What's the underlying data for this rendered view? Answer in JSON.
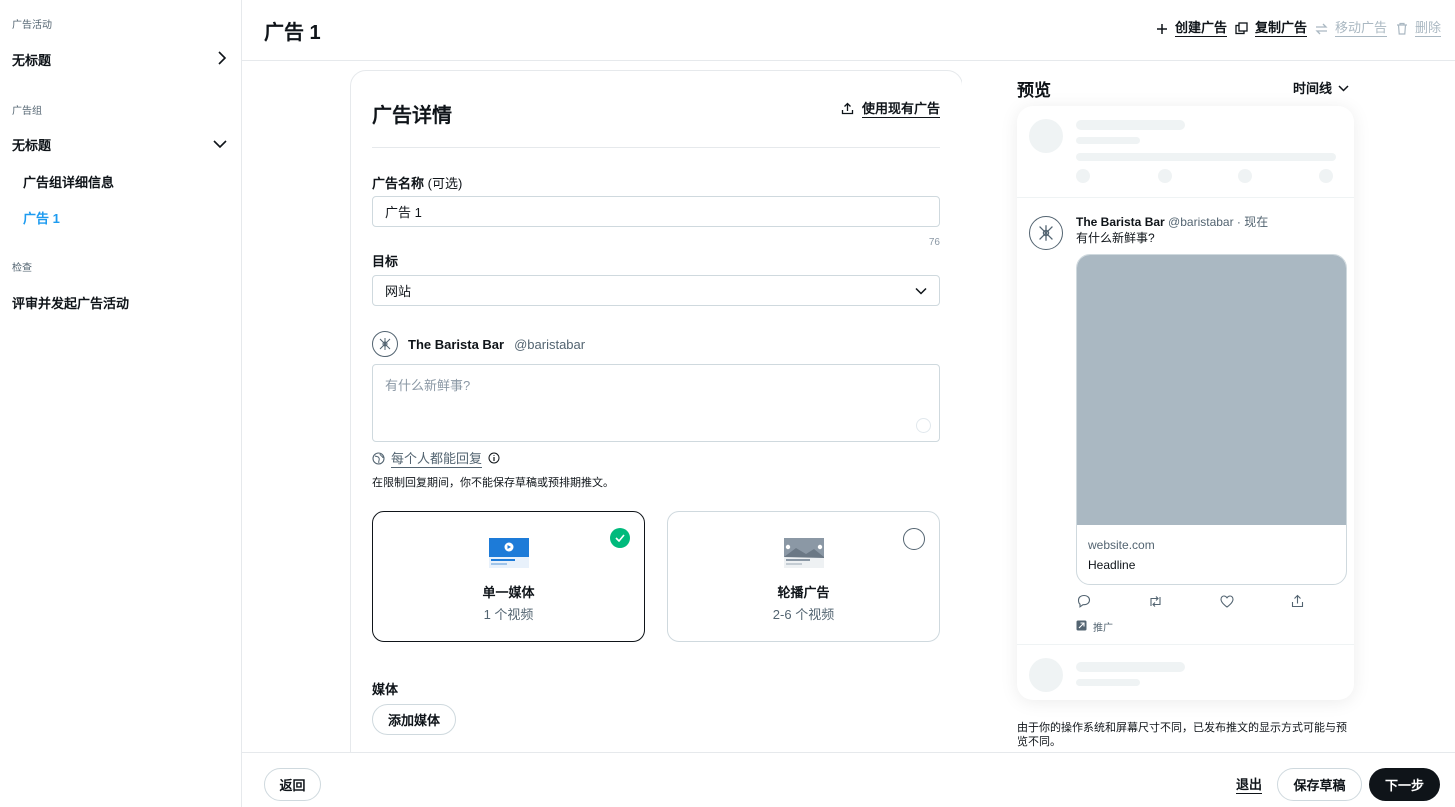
{
  "sidebar": {
    "section_campaign": "广告活动",
    "campaign_item": "无标题",
    "section_adgroup": "广告组",
    "adgroup_item": "无标题",
    "adgroup_details": "广告组详细信息",
    "ad_item": "广告 1",
    "section_review": "检查",
    "review_item": "评审并发起广告活动"
  },
  "header": {
    "title": "广告 1",
    "create_ad": "创建广告",
    "copy_ad": "复制广告",
    "move_ad": "移动广告",
    "delete": "删除"
  },
  "details": {
    "title": "广告详情",
    "use_existing": "使用现有广告",
    "name_label": "广告名称",
    "name_optional": "(可选)",
    "name_value": "广告 1",
    "name_counter": "76",
    "goal_label": "目标",
    "goal_value": "网站",
    "account_name": "The Barista Bar",
    "account_handle": "@baristabar",
    "tweet_placeholder": "有什么新鲜事?",
    "reply_setting": "每个人都能回复",
    "reply_note": "在限制回复期间，你不能保存草稿或预排期推文。",
    "single_media_title": "单一媒体",
    "single_media_sub": "1 个视频",
    "carousel_title": "轮播广告",
    "carousel_sub": "2-6 个视频",
    "media_label": "媒体",
    "add_media": "添加媒体"
  },
  "preview": {
    "title": "预览",
    "placement": "时间线",
    "tweet_name": "The Barista Bar",
    "tweet_handle": "@baristabar · 现在",
    "tweet_text": "有什么新鲜事?",
    "card_domain": "website.com",
    "card_headline": "Headline",
    "promoted": "推广",
    "note": "由于你的操作系统和屏幕尺寸不同，已发布推文的显示方式可能与预览不同。"
  },
  "footer": {
    "back": "返回",
    "exit": "退出",
    "save_draft": "保存草稿",
    "next": "下一步"
  },
  "colors": {
    "accent_blue": "#1d9bf0",
    "check_green": "#00ba7c",
    "media_placeholder": "#aab8c2",
    "primary_dark": "#0f1419"
  }
}
